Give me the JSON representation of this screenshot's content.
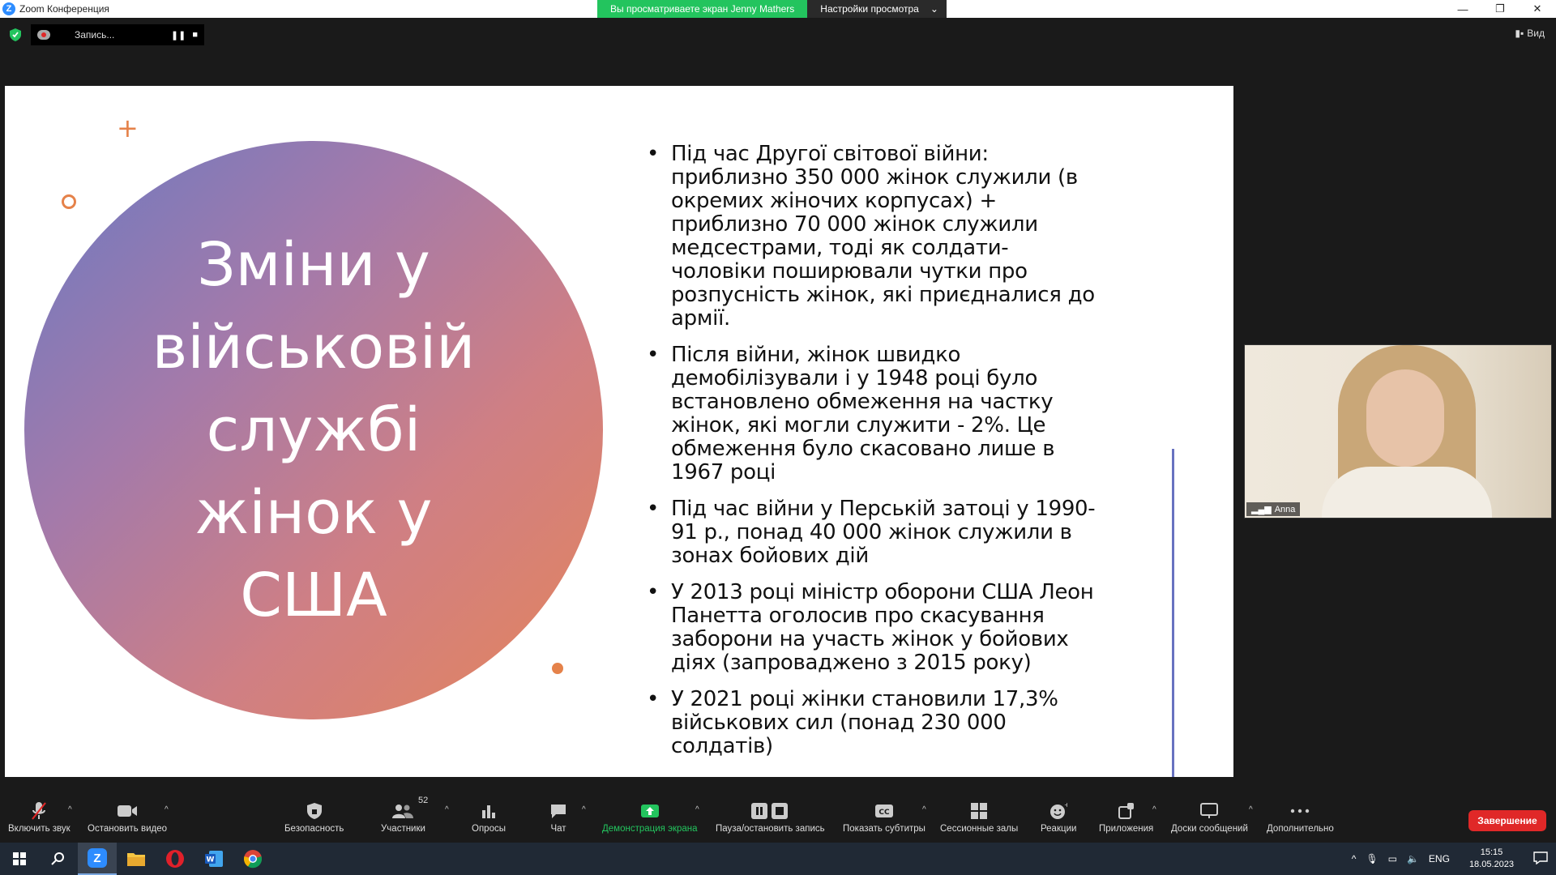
{
  "window": {
    "title": "Zoom Конференция",
    "controls": [
      "minimize",
      "restore",
      "close"
    ]
  },
  "share_banner": {
    "viewing": "Вы просматриваете экран Jenny Mathers",
    "options": "Настройки просмотра"
  },
  "recording": {
    "label": "Запись...",
    "pause_icon": "pause-icon",
    "stop_icon": "stop-icon"
  },
  "view_button": "Вид",
  "slide": {
    "title": "Зміни у військовій службі жінок у США",
    "bullets": [
      "Під час Другої світової війни: приблизно 350 000 жінок служили (в окремих жіночих корпусах) + приблизно 70 000 жінок служили медсестрами, тоді як солдати-чоловіки поширювали чутки про розпусність жінок, які приєдналися до армії.",
      "Після війни, жінок швидко демобілізували і у 1948 році було встановлено обмеження на частку жінок, які могли служити - 2%. Це обмеження було скасовано лише в 1967 році",
      "Під час війни у Перській затоці у 1990-91 р., понад 40 000 жінок служили в зонах бойових дій",
      "У 2013 році міністр оборони США Леон Панетта оголосив про скасування заборони на участь жінок у бойових діях (запроваджено з 2015 року)",
      "У 2021 році жінки становили 17,3% військових сил (понад 230 000 солдатів)"
    ],
    "colors": {
      "gradient_start": "#6a79c2",
      "gradient_end": "#e5855a",
      "accent": "#e5824a"
    }
  },
  "participant": {
    "name": "Anna"
  },
  "toolbar": {
    "unmute": "Включить звук",
    "stop_video": "Остановить видео",
    "security": "Безопасность",
    "participants": "Участники",
    "participants_count": "52",
    "polls": "Опросы",
    "chat": "Чат",
    "share_screen": "Демонстрация экрана",
    "pause_record": "Пауза/остановить запись",
    "captions": "Показать субтитры",
    "breakout": "Сессионные залы",
    "reactions": "Реакции",
    "apps": "Приложения",
    "whiteboards": "Доски сообщений",
    "more": "Дополнительно",
    "end": "Завершение"
  },
  "taskbar": {
    "language": "ENG",
    "time": "15:15",
    "date": "18.05.2023"
  }
}
